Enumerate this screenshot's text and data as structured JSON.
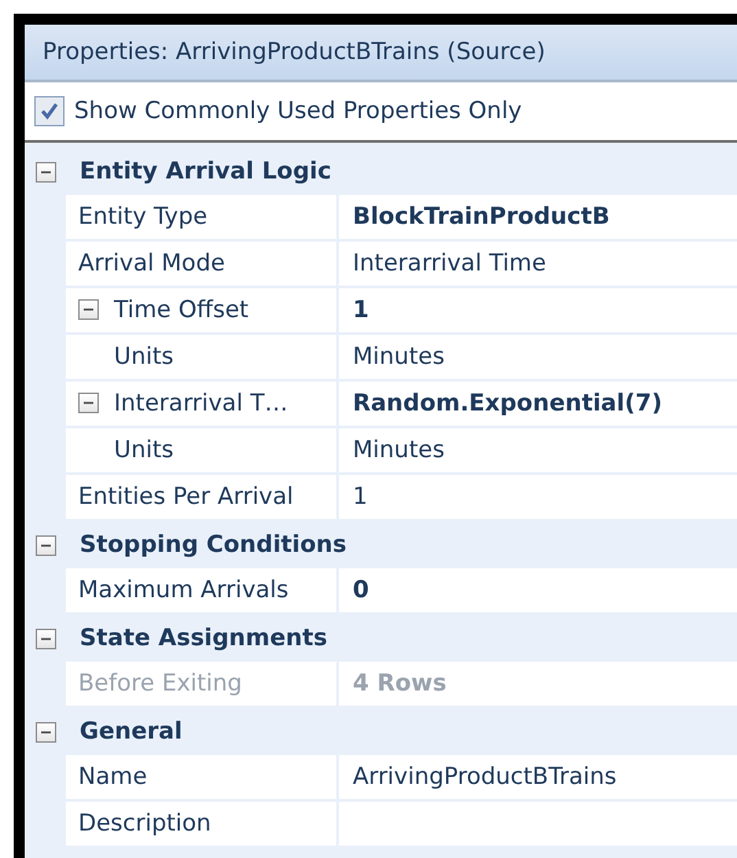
{
  "window": {
    "title": "Properties: ArrivingProductBTrains (Source)"
  },
  "filter": {
    "label": "Show Commonly Used Properties Only",
    "checked": true
  },
  "sections": [
    {
      "title": "Entity Arrival Logic",
      "expanded": true,
      "properties": [
        {
          "name": "Entity Type",
          "value": "BlockTrainProductB",
          "modified": true,
          "disabled": false
        },
        {
          "name": "Arrival Mode",
          "value": "Interarrival Time",
          "modified": false,
          "disabled": false
        },
        {
          "name": "Time Offset",
          "value": "1",
          "modified": true,
          "disabled": false,
          "expanded": true,
          "children": [
            {
              "name": "Units",
              "value": "Minutes",
              "modified": false,
              "disabled": false
            }
          ]
        },
        {
          "name": "Interarrival T…",
          "value": "Random.Exponential(7)",
          "modified": true,
          "disabled": false,
          "expanded": true,
          "children": [
            {
              "name": "Units",
              "value": "Minutes",
              "modified": false,
              "disabled": false
            }
          ]
        },
        {
          "name": "Entities Per Arrival",
          "value": "1",
          "modified": false,
          "disabled": false
        }
      ]
    },
    {
      "title": "Stopping Conditions",
      "expanded": true,
      "properties": [
        {
          "name": "Maximum Arrivals",
          "value": "0",
          "modified": true,
          "disabled": false
        }
      ]
    },
    {
      "title": "State Assignments",
      "expanded": true,
      "properties": [
        {
          "name": "Before Exiting",
          "value": "4 Rows",
          "modified": true,
          "disabled": true
        }
      ]
    },
    {
      "title": "General",
      "expanded": true,
      "properties": [
        {
          "name": "Name",
          "value": "ArrivingProductBTrains",
          "modified": false,
          "disabled": false
        },
        {
          "name": "Description",
          "disabled": false
        }
      ]
    }
  ]
}
